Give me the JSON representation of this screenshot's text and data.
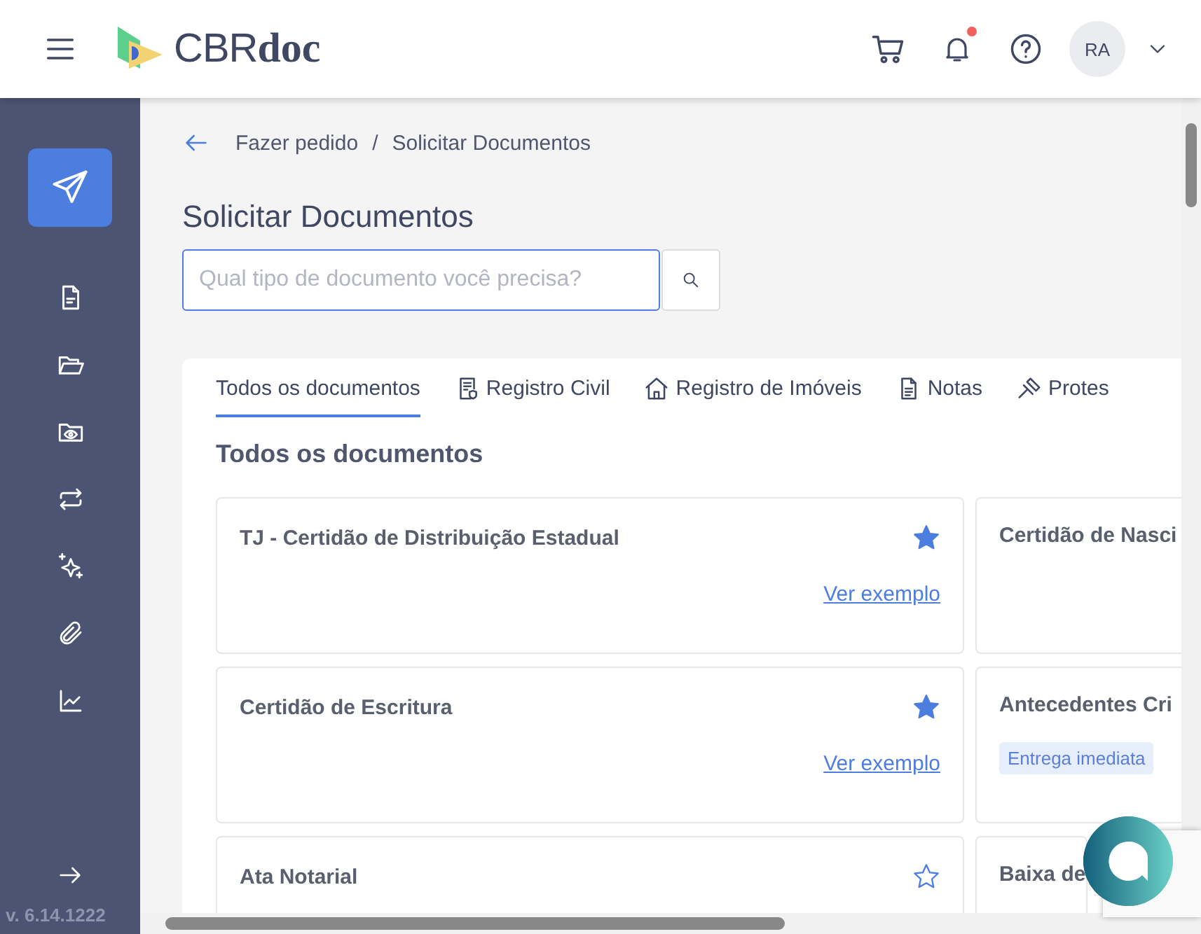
{
  "header": {
    "logo_light": "CBR",
    "logo_bold": "doc",
    "has_notification": true,
    "avatar": "RA"
  },
  "sidebar": {
    "items": [
      {
        "kind": "send",
        "selected": true
      },
      {
        "kind": "file",
        "selected": false
      },
      {
        "kind": "folder",
        "selected": false
      },
      {
        "kind": "folder-eye",
        "selected": false
      },
      {
        "kind": "repeat",
        "selected": false
      },
      {
        "kind": "sparkles",
        "selected": false
      },
      {
        "kind": "clip",
        "selected": false
      },
      {
        "kind": "chart",
        "selected": false
      }
    ],
    "version": "v. 6.14.1222"
  },
  "breadcrumb": [
    "Fazer pedido",
    "/",
    "Solicitar Documentos"
  ],
  "title": "Solicitar Documentos",
  "search": {
    "placeholder": "Qual tipo de documento você precisa?"
  },
  "tabs": [
    {
      "label": "Todos os documentos",
      "kind": "all",
      "selected": true
    },
    {
      "label": "Registro Civil",
      "kind": "civil",
      "selected": false
    },
    {
      "label": "Registro de Imóveis",
      "kind": "property",
      "selected": false
    },
    {
      "label": "Notas",
      "kind": "notes",
      "selected": false
    },
    {
      "label": "Protes",
      "kind": "protest",
      "selected": false
    }
  ],
  "section_title": "Todos os documentos",
  "cards": [
    {
      "title": "TJ - Certidão de Distribuição Estadual",
      "favorite": true,
      "link": "Ver exemplo"
    },
    {
      "title": "Certidão de Nasci"
    },
    {
      "title": "Certidão de Escritura",
      "favorite": true,
      "link": "Ver exemplo"
    },
    {
      "title": "Antecedentes Cri",
      "badge": "Entrega imediata"
    },
    {
      "title": "Ata Notarial",
      "favorite": false
    },
    {
      "title": "Baixa de"
    }
  ]
}
